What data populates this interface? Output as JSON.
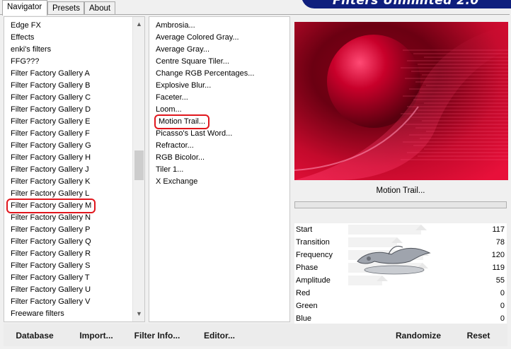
{
  "tabs": [
    {
      "label": "Navigator",
      "active": true
    },
    {
      "label": "Presets",
      "active": false
    },
    {
      "label": "About",
      "active": false
    }
  ],
  "banner_text": "Filters Unlimited 2.0",
  "categories": [
    "Edge FX",
    "Effects",
    "enki's filters",
    "FFG???",
    "Filter Factory Gallery A",
    "Filter Factory Gallery B",
    "Filter Factory Gallery C",
    "Filter Factory Gallery D",
    "Filter Factory Gallery E",
    "Filter Factory Gallery F",
    "Filter Factory Gallery G",
    "Filter Factory Gallery H",
    "Filter Factory Gallery J",
    "Filter Factory Gallery K",
    "Filter Factory Gallery L",
    "Filter Factory Gallery M",
    "Filter Factory Gallery N",
    "Filter Factory Gallery P",
    "Filter Factory Gallery Q",
    "Filter Factory Gallery R",
    "Filter Factory Gallery S",
    "Filter Factory Gallery T",
    "Filter Factory Gallery U",
    "Filter Factory Gallery V",
    "Freeware filters"
  ],
  "selected_category": "Filter Factory Gallery M",
  "filters": [
    "Ambrosia...",
    "Average Colored Gray...",
    "Average Gray...",
    "Centre Square Tiler...",
    "Change RGB Percentages...",
    "Explosive Blur...",
    "Faceter...",
    "Loom...",
    "Motion Trail...",
    "Picasso's Last Word...",
    "Refractor...",
    "RGB Bicolor...",
    "Tiler 1...",
    "X Exchange"
  ],
  "selected_filter": "Motion Trail...",
  "preview_filter_name": "Motion Trail...",
  "parameters": [
    {
      "label": "Start",
      "value": "117",
      "level": 0.459
    },
    {
      "label": "Transition",
      "value": "78",
      "level": 0.306
    },
    {
      "label": "Frequency",
      "value": "120",
      "level": 0.471
    },
    {
      "label": "Phase",
      "value": "119",
      "level": 0.467
    },
    {
      "label": "Amplitude",
      "value": "55",
      "level": 0.216
    },
    {
      "label": "Red",
      "value": "0",
      "level": 0
    },
    {
      "label": "Green",
      "value": "0",
      "level": 0
    },
    {
      "label": "Blue",
      "value": "0",
      "level": 0
    }
  ],
  "buttons": {
    "database": "Database",
    "import": "Import...",
    "filter_info": "Filter Info...",
    "editor": "Editor...",
    "randomize": "Randomize",
    "reset": "Reset"
  },
  "colors": {
    "banner": "#0f1f7d",
    "highlight": "#e0161d",
    "preview_dark": "#6b0012",
    "preview_bright": "#e8103a"
  }
}
